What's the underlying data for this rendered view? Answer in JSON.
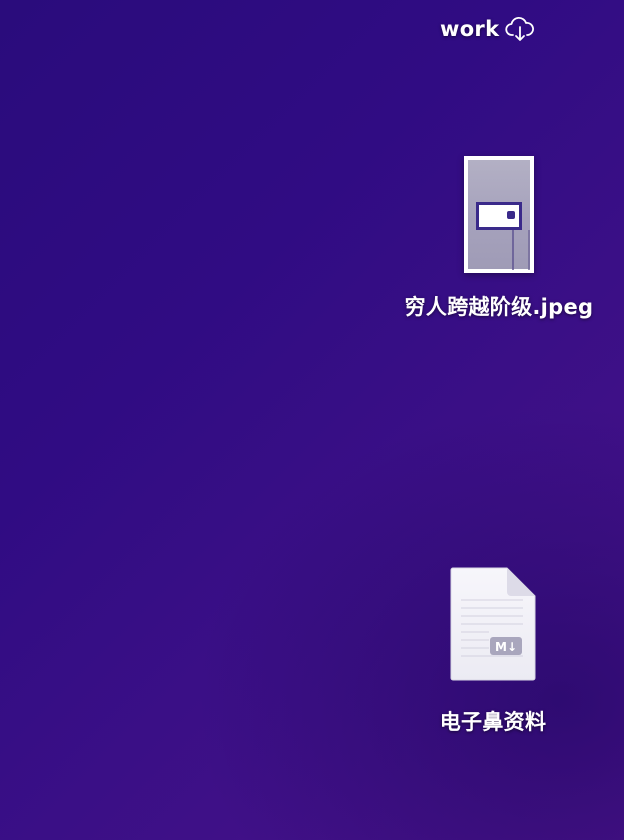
{
  "desktop": {
    "items": [
      {
        "label": "work",
        "icon": "cloud-download-icon",
        "kind": "folder"
      },
      {
        "label": "穷人跨越阶级.jpeg",
        "icon": "image-thumbnail",
        "kind": "image"
      },
      {
        "label": "电子鼻资料",
        "icon": "markdown-document-icon",
        "kind": "markdown"
      }
    ],
    "md_badge": "M↓"
  },
  "colors": {
    "background": "#300c83",
    "label": "#ffffff"
  }
}
